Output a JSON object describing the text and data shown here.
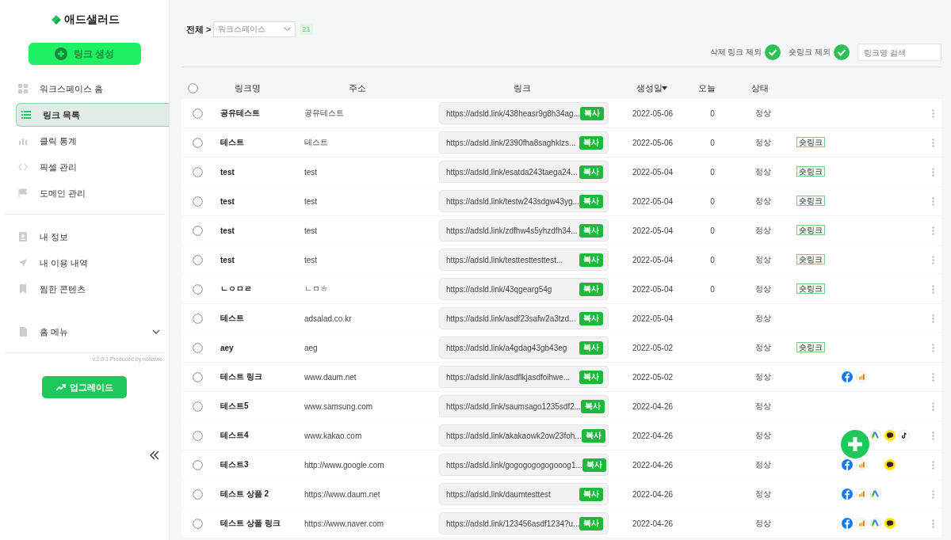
{
  "logo": {
    "text": "애드샐러드"
  },
  "sidebar": {
    "create_button": "링크 생성",
    "groups": [
      [
        {
          "label": "워크스페이스 홈",
          "selected": false
        },
        {
          "label": "링크 목록",
          "selected": true
        },
        {
          "label": "클릭 통계",
          "selected": false
        },
        {
          "label": "픽셀 관리",
          "selected": false
        },
        {
          "label": "도메인 관리",
          "selected": false
        }
      ],
      [
        {
          "label": "내 정보",
          "selected": false
        },
        {
          "label": "내 이용 내역",
          "selected": false
        },
        {
          "label": "찜한 콘텐츠",
          "selected": false
        }
      ],
      [
        {
          "label": "홈 메뉴",
          "selected": false,
          "kind": "dropdown"
        }
      ]
    ],
    "version": "v.2.0.1 Produced by nollabro",
    "upgrade_button": "업그레이드"
  },
  "toolbar": {
    "breadcrumb": "전체 >",
    "workspace": "워크스페이스",
    "count": "21",
    "filters": [
      {
        "label": "삭제 링크 제외",
        "on": true
      },
      {
        "label": "숏링크 제외",
        "on": true
      }
    ],
    "search": {
      "placeholder": "링크명 검색"
    }
  },
  "table": {
    "select_all": {
      "selected": false
    },
    "columns": [
      "링크명",
      "주소",
      "링크",
      "생성일",
      "오늘",
      "상태"
    ],
    "rows": [
      {
        "name": "공유테스트",
        "address": "공유테스트",
        "link": "https://adsld.link/438heasr9g8h34ag...",
        "copy": "복사",
        "date": "2022-05-06",
        "today": "0",
        "status": "정상",
        "selected": false,
        "pixels": []
      },
      {
        "name": "테스트",
        "address": "테스트",
        "link": "https://adsld.link/2390fha8saghklzs...",
        "copy": "복사",
        "date": "2022-05-06",
        "today": "0",
        "status": "정상",
        "tag": "숏링크",
        "selected": false,
        "pixels": []
      },
      {
        "name": "test",
        "address": "test",
        "link": "https://adsld.link/esatda243taega24...",
        "copy": "복사",
        "date": "2022-05-04",
        "today": "0",
        "status": "정상",
        "tag": "숏링크",
        "selected": false,
        "pixels": []
      },
      {
        "name": "test",
        "address": "test",
        "link": "https://adsld.link/testw243sdgw43yg...",
        "copy": "복사",
        "date": "2022-05-04",
        "today": "0",
        "status": "정상",
        "tag": "숏링크",
        "selected": false,
        "pixels": []
      },
      {
        "name": "test",
        "address": "test",
        "link": "https://adsld.link/zdfhw4s5yhzdfh34...",
        "copy": "복사",
        "date": "2022-05-04",
        "today": "0",
        "status": "정상",
        "tag": "숏링크",
        "selected": false,
        "pixels": []
      },
      {
        "name": "test",
        "address": "test",
        "link": "https://adsld.link/testtesttesttest...",
        "copy": "복사",
        "date": "2022-05-04",
        "today": "0",
        "status": "정상",
        "tag": "숏링크",
        "selected": false,
        "pixels": []
      },
      {
        "name": "ㄴㅇㅁㄹ",
        "address": "ㄴㅁㅎ",
        "link": "https://adsld.link/43qgearg54g",
        "copy": "복사",
        "date": "2022-05-04",
        "today": "0",
        "status": "정상",
        "tag": "숏링크",
        "selected": false,
        "pixels": []
      },
      {
        "name": "테스트",
        "address": "adsalad.co.kr",
        "link": "https://adsld.link/asdf23safw2a3tzd...",
        "copy": "복사",
        "date": "2022-05-04",
        "status": "정상",
        "selected": false,
        "pixels": []
      },
      {
        "name": "aey",
        "address": "aeg",
        "link": "https://adsld.link/a4gdag43gb43eg",
        "copy": "복사",
        "date": "2022-05-02",
        "status": "정상",
        "tag": "숏링크",
        "selected": false,
        "pixels": []
      },
      {
        "name": "테스트 링크",
        "address": "www.daum.net",
        "link": "https://adsld.link/asdflkjasdfoihwe...",
        "copy": "복사",
        "date": "2022-05-02",
        "status": "정상",
        "selected": false,
        "pixels": [
          {
            "kind": "facebook"
          },
          {
            "kind": "analytics"
          }
        ]
      },
      {
        "name": "테스트5",
        "address": "www.samsung.com",
        "link": "https://adsld.link/saumsago1235sdf2...",
        "copy": "복사",
        "date": "2022-04-26",
        "status": "정상",
        "selected": false,
        "pixels": []
      },
      {
        "name": "테스트4",
        "address": "www.kakao.com",
        "link": "https://adsld.link/akakaowk2ow23foh...",
        "copy": "복사",
        "date": "2022-04-26",
        "status": "정상",
        "selected": false,
        "pixels": [
          {
            "kind": "ads"
          },
          {
            "kind": "kakao"
          },
          {
            "kind": "tiktok"
          }
        ]
      },
      {
        "name": "테스트3",
        "address": "http://www.google.com",
        "link": "https://adsld.link/gogogogogogooog1...",
        "copy": "복사",
        "date": "2022-04-26",
        "status": "정상",
        "selected": false,
        "pixels": [
          {
            "kind": "facebook"
          },
          {
            "kind": "analytics"
          },
          {
            "kind": "kakao"
          }
        ]
      },
      {
        "name": "테스트 상품 2",
        "address": "https://www.daum.net",
        "link": "https://adsld.link/daumtesttest",
        "copy": "복사",
        "date": "2022-04-26",
        "status": "정상",
        "selected": false,
        "pixels": [
          {
            "kind": "facebook"
          },
          {
            "kind": "analytics"
          },
          {
            "kind": "ads"
          }
        ]
      },
      {
        "name": "테스트 상품 링크",
        "address": "https://www.naver.com",
        "link": "https://adsld.link/123456asdf1234?u...",
        "copy": "복사",
        "date": "2022-04-26",
        "status": "정상",
        "selected": false,
        "pixels": [
          {
            "kind": "facebook"
          },
          {
            "kind": "analytics"
          },
          {
            "kind": "ads"
          },
          {
            "kind": "kakao"
          }
        ]
      }
    ]
  }
}
